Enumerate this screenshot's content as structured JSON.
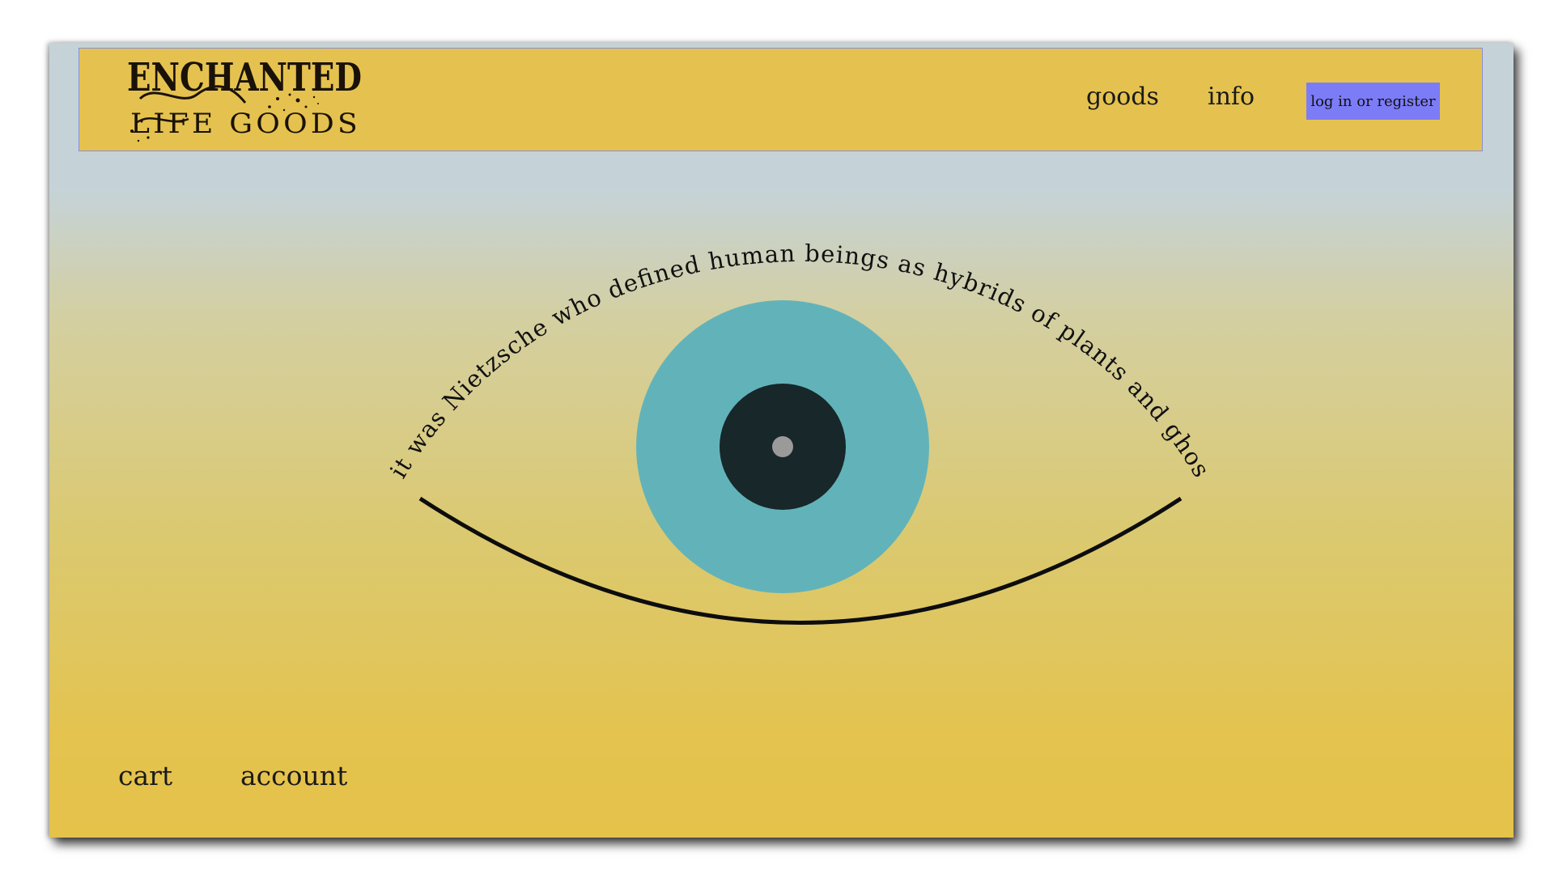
{
  "header": {
    "logo": {
      "line1": "ENCHANTED",
      "line2": "LIFE GOODS"
    },
    "nav": {
      "goods": "goods",
      "info": "info"
    },
    "login_label": "log in or register"
  },
  "hero": {
    "quote": "it was Nietzsche who defined human beings as hybrids of plants and ghosts"
  },
  "footer": {
    "cart": "cart",
    "account": "account"
  },
  "colors": {
    "header_bg": "#e5c24f",
    "login_button": "#7d7cf7",
    "iris": "#62b3b9",
    "pupil": "#18272a",
    "highlight": "#9a9a9a"
  }
}
